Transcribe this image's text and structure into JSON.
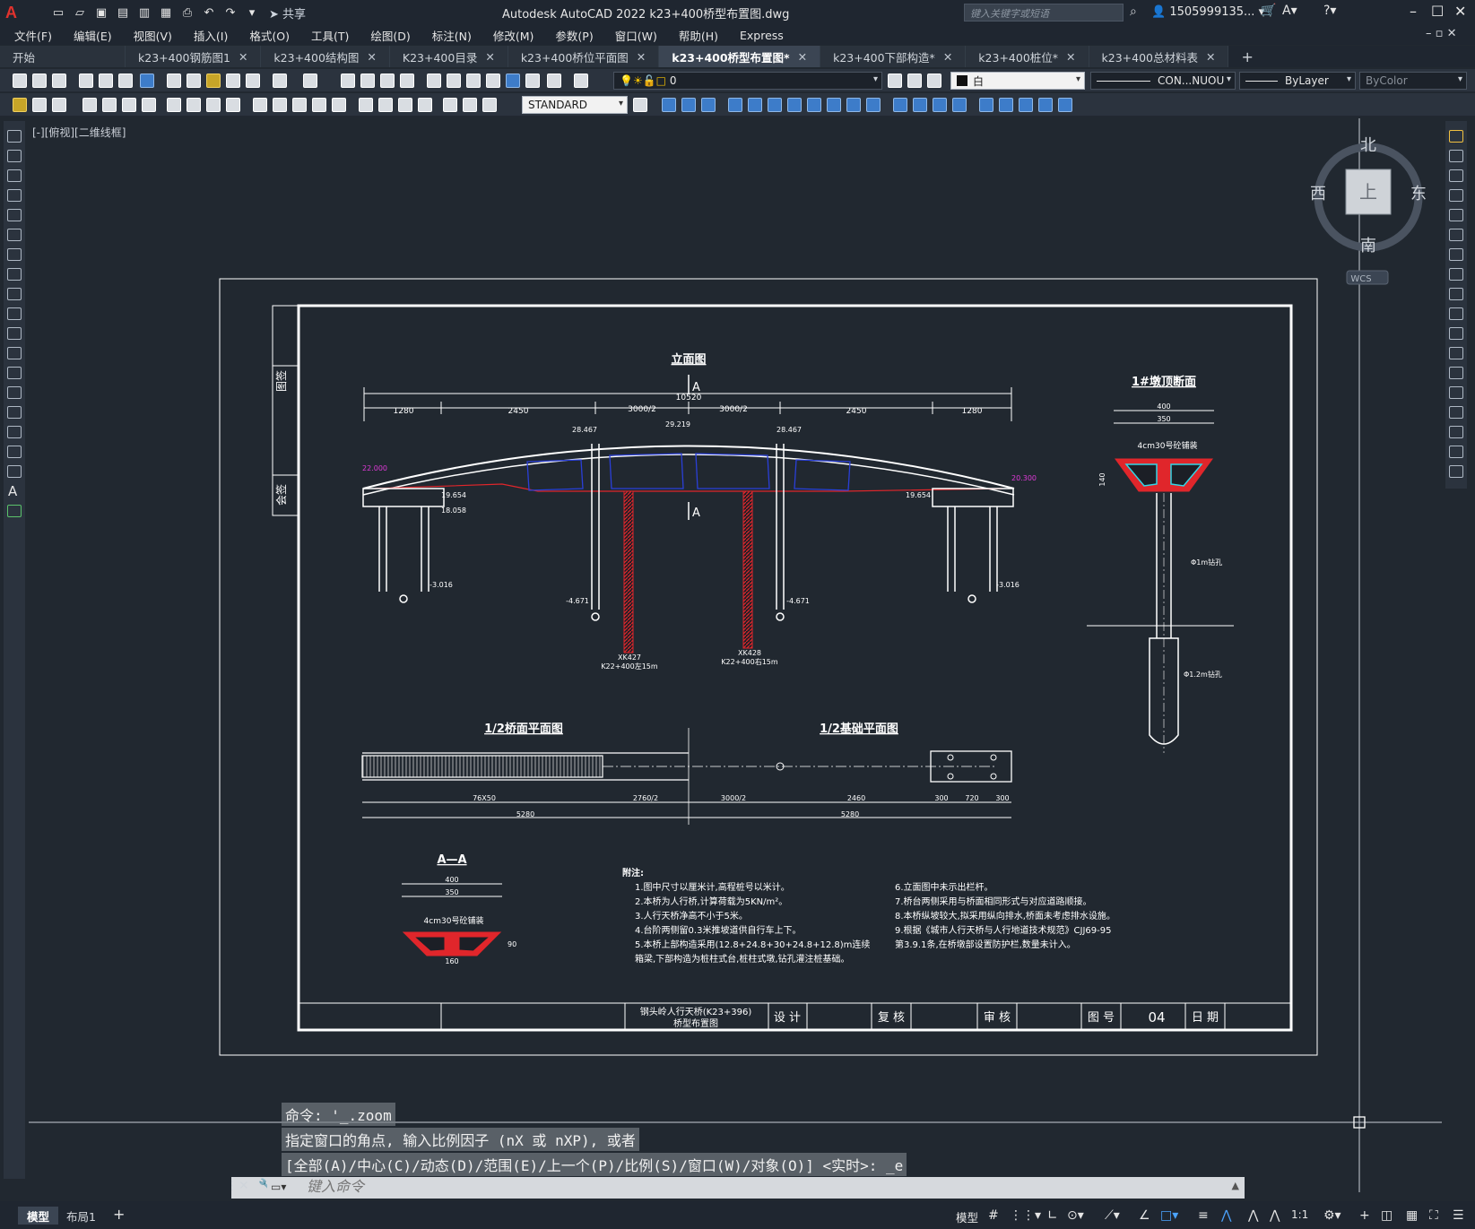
{
  "app": {
    "logo": "A",
    "title": "Autodesk AutoCAD 2022    k23+400桥型布置图.dwg",
    "share_label": "共享",
    "search_placeholder": "键入关键字或短语",
    "user": "1505999135...",
    "quick_access_icons": [
      "new-icon",
      "open-icon",
      "save-icon",
      "saveas-icon",
      "publish-icon",
      "plot-icon",
      "print-icon",
      "undo-icon",
      "redo-icon"
    ]
  },
  "menu": [
    "文件(F)",
    "编辑(E)",
    "视图(V)",
    "插入(I)",
    "格式(O)",
    "工具(T)",
    "绘图(D)",
    "标注(N)",
    "修改(M)",
    "参数(P)",
    "窗口(W)",
    "帮助(H)",
    "Express"
  ],
  "tabs": [
    {
      "label": "开始",
      "close": false
    },
    {
      "label": "k23+400钢筋图1",
      "close": true
    },
    {
      "label": "k23+400结构图",
      "close": true
    },
    {
      "label": "K23+400目录",
      "close": true
    },
    {
      "label": "k23+400桥位平面图",
      "close": true
    },
    {
      "label": "k23+400桥型布置图*",
      "close": true,
      "active": true
    },
    {
      "label": "k23+400下部构造*",
      "close": true
    },
    {
      "label": "k23+400桩位*",
      "close": true
    },
    {
      "label": "k23+400总材料表",
      "close": true
    }
  ],
  "toolbar": {
    "layer_value": "0",
    "color_value": "白",
    "linetype_value": "CON...NUOU",
    "lineweight_value": "ByLayer",
    "plotstyle_value": "ByColor",
    "textstyle_value": "STANDARD"
  },
  "viewport": {
    "label": "[-][俯视][二维线框]",
    "compass": {
      "north": "北",
      "south": "南",
      "east": "东",
      "west": "西",
      "top": "上",
      "wcs": "WCS"
    }
  },
  "drawing": {
    "side_labels": [
      "图签",
      "会签"
    ],
    "elevation_title": "立面图",
    "section_mark": "A",
    "top_dims": [
      "1280",
      "2450",
      "3000/2",
      "3000/2",
      "2450",
      "1280"
    ],
    "total_dim": "10520",
    "elev_labels": [
      "28.467",
      "29.219",
      "28.467",
      "22.000",
      "20.300",
      "19.654",
      "19.654",
      "18.058",
      "-3.016",
      "-3.016",
      "-4.671",
      "-4.671"
    ],
    "pile_labels": [
      "XK427",
      "K22+400左15m",
      "XK428",
      "K22+400右15m"
    ],
    "pier_section_title": "1#墩顶断面",
    "pier_dims": [
      "400",
      "350",
      "4cm30号砼铺装",
      "140",
      "Φ1m钻孔",
      "Φ1.2m钻孔"
    ],
    "half_deck_title": "1/2桥面平面图",
    "half_found_title": "1/2基础平面图",
    "plan_dims": [
      "76X50",
      "2760/2",
      "3000/2",
      "2460",
      "300",
      "720",
      "300",
      "5280",
      "5280"
    ],
    "aa_title": "A—A",
    "aa_dims": [
      "400",
      "350",
      "4cm30号砼铺装",
      "160",
      "90"
    ],
    "notes_title": "附注:",
    "notes_left": [
      "1.图中尺寸以厘米计,高程桩号以米计。",
      "2.本桥为人行桥,计算荷载为5KN/m²。",
      "3.人行天桥净高不小于5米。",
      "4.台阶两侧留0.3米推坡道供自行车上下。",
      "5.本桥上部构造采用(12.8+24.8+30+24.8+12.8)m连续",
      "  箱梁,下部构造为桩柱式台,桩柱式墩,钻孔灌注桩基础。"
    ],
    "notes_right": [
      "6.立面图中未示出栏杆。",
      "7.桥台两侧采用与桥面相同形式与对应道路顺接。",
      "8.本桥纵坡较大,拟采用纵向排水,桥面未考虑排水设施。",
      "9.根据《城市人行天桥与人行地道技术规范》CJJ69-95",
      "  第3.9.1条,在桥墩部设置防护栏,数量未计入。"
    ],
    "titleblock": {
      "project": "钢头岭人行天桥(K23+396)",
      "sheet_name": "桥型布置图",
      "design": "设 计",
      "check": "复 核",
      "review": "审 核",
      "sheet_no_label": "图 号",
      "sheet_no": "04",
      "date_label": "日 期"
    }
  },
  "command": {
    "history": [
      "命令: '_.zoom",
      "指定窗口的角点, 输入比例因子 (nX 或 nXP), 或者",
      "[全部(A)/中心(C)/动态(D)/范围(E)/上一个(P)/比例(S)/窗口(W)/对象(O)] <实时>: _e"
    ],
    "placeholder": "键入命令"
  },
  "status": {
    "layout_tabs": [
      "模型",
      "布局1"
    ],
    "model_label": "模型",
    "scale": "1:1"
  },
  "colors": {
    "background": "#212830",
    "drawing_white": "#ffffff",
    "red": "#e0262b",
    "cyan": "#33d6e6",
    "magenta": "#e03ad8",
    "blue": "#2a3fd8"
  }
}
